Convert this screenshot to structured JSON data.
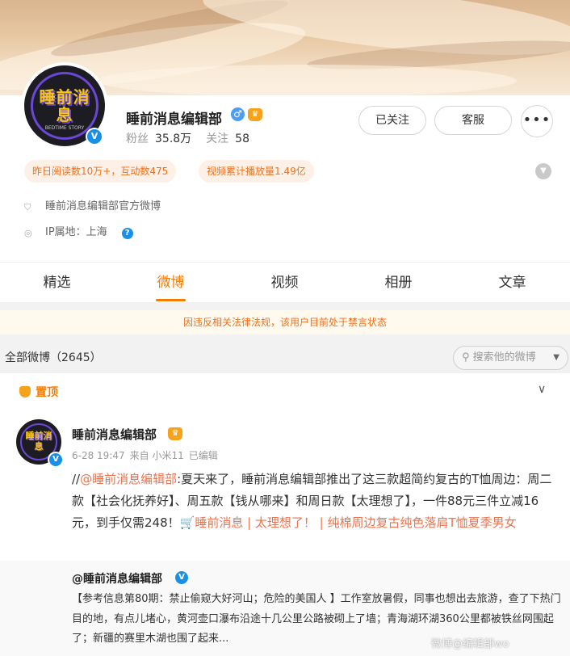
{
  "profile": {
    "name": "睡前消息编辑部",
    "gender_symbol": "♂",
    "fans_label": "粉丝",
    "fans_value": "35.8万",
    "follow_label": "关注",
    "follow_value": "58",
    "avatar_text": "睡前消息",
    "avatar_sub": "BEDTIME STORY",
    "verified_symbol": "V",
    "buttons": {
      "followed": "已关注",
      "service": "客服",
      "more": "•••"
    },
    "pills": [
      "昨日阅读数10万+，互动数475",
      "视频累计播放量1.49亿"
    ],
    "official": "睡前消息编辑部官方微博",
    "ip": "IP属地：上海",
    "help_symbol": "?"
  },
  "tabs": [
    {
      "label": "精选",
      "active": false
    },
    {
      "label": "微博",
      "active": true
    },
    {
      "label": "视频",
      "active": false
    },
    {
      "label": "相册",
      "active": false
    },
    {
      "label": "文章",
      "active": false
    }
  ],
  "notice": "因违反相关法律法规，该用户目前处于禁言状态",
  "list": {
    "title": "全部微博（2645）",
    "search_placeholder": "搜索他的微博"
  },
  "post": {
    "pinned_label": "置顶",
    "author": "睡前消息编辑部",
    "time": "6-28 19:47",
    "source": "来自 小米11",
    "edited": "已编辑",
    "text_prefix": "//",
    "mention": "@睡前消息编辑部",
    "text_main": ":夏天来了，睡前消息编辑部推出了这三款超简约复古的T恤周边：周二款【社会化抚养好】、周五款【钱从哪来】和周日款【太理想了】，一件88元三件立减16元，到手仅需248！",
    "shop_link": "睡前消息 | 太理想了！ | 纯棉周边复古纯色落肩T恤夏季男女",
    "retweet_author": "@睡前消息编辑部",
    "retweet_text": "【参考信息第80期：禁止偷窥大好河山；危险的美国人 】工作室放暑假，同事也想出去旅游，查了下热门目的地，有点儿堵心，黄河壶口瀑布沿途十几公里公路被砌上了墙；青海湖环湖360公里都被铁丝网围起了；新疆的赛里木湖也围了起来..."
  },
  "watermark": "微博@编辑部wo",
  "colors": {
    "accent": "#f57c00",
    "link": "#eb7350",
    "verified": "#1890e8",
    "pill_text": "#f0711d"
  }
}
